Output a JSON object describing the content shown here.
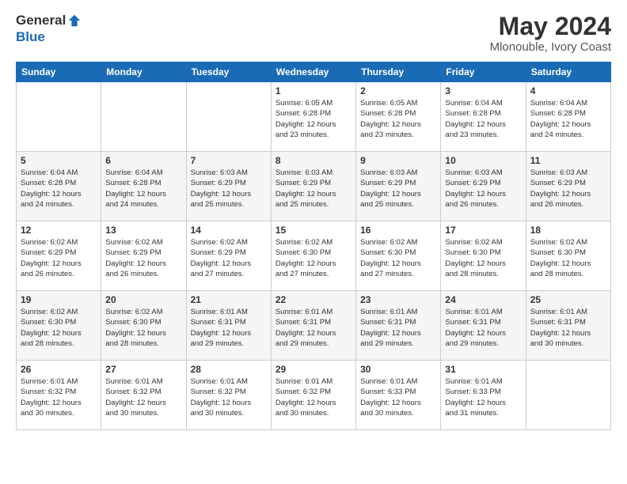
{
  "header": {
    "logo_general": "General",
    "logo_blue": "Blue",
    "month_title": "May 2024",
    "location": "Mlonouble, Ivory Coast"
  },
  "calendar": {
    "days_of_week": [
      "Sunday",
      "Monday",
      "Tuesday",
      "Wednesday",
      "Thursday",
      "Friday",
      "Saturday"
    ],
    "weeks": [
      [
        {
          "day": "",
          "info": ""
        },
        {
          "day": "",
          "info": ""
        },
        {
          "day": "",
          "info": ""
        },
        {
          "day": "1",
          "info": "Sunrise: 6:05 AM\nSunset: 6:28 PM\nDaylight: 12 hours\nand 23 minutes."
        },
        {
          "day": "2",
          "info": "Sunrise: 6:05 AM\nSunset: 6:28 PM\nDaylight: 12 hours\nand 23 minutes."
        },
        {
          "day": "3",
          "info": "Sunrise: 6:04 AM\nSunset: 6:28 PM\nDaylight: 12 hours\nand 23 minutes."
        },
        {
          "day": "4",
          "info": "Sunrise: 6:04 AM\nSunset: 6:28 PM\nDaylight: 12 hours\nand 24 minutes."
        }
      ],
      [
        {
          "day": "5",
          "info": "Sunrise: 6:04 AM\nSunset: 6:28 PM\nDaylight: 12 hours\nand 24 minutes."
        },
        {
          "day": "6",
          "info": "Sunrise: 6:04 AM\nSunset: 6:28 PM\nDaylight: 12 hours\nand 24 minutes."
        },
        {
          "day": "7",
          "info": "Sunrise: 6:03 AM\nSunset: 6:29 PM\nDaylight: 12 hours\nand 25 minutes."
        },
        {
          "day": "8",
          "info": "Sunrise: 6:03 AM\nSunset: 6:29 PM\nDaylight: 12 hours\nand 25 minutes."
        },
        {
          "day": "9",
          "info": "Sunrise: 6:03 AM\nSunset: 6:29 PM\nDaylight: 12 hours\nand 25 minutes."
        },
        {
          "day": "10",
          "info": "Sunrise: 6:03 AM\nSunset: 6:29 PM\nDaylight: 12 hours\nand 26 minutes."
        },
        {
          "day": "11",
          "info": "Sunrise: 6:03 AM\nSunset: 6:29 PM\nDaylight: 12 hours\nand 26 minutes."
        }
      ],
      [
        {
          "day": "12",
          "info": "Sunrise: 6:02 AM\nSunset: 6:29 PM\nDaylight: 12 hours\nand 26 minutes."
        },
        {
          "day": "13",
          "info": "Sunrise: 6:02 AM\nSunset: 6:29 PM\nDaylight: 12 hours\nand 26 minutes."
        },
        {
          "day": "14",
          "info": "Sunrise: 6:02 AM\nSunset: 6:29 PM\nDaylight: 12 hours\nand 27 minutes."
        },
        {
          "day": "15",
          "info": "Sunrise: 6:02 AM\nSunset: 6:30 PM\nDaylight: 12 hours\nand 27 minutes."
        },
        {
          "day": "16",
          "info": "Sunrise: 6:02 AM\nSunset: 6:30 PM\nDaylight: 12 hours\nand 27 minutes."
        },
        {
          "day": "17",
          "info": "Sunrise: 6:02 AM\nSunset: 6:30 PM\nDaylight: 12 hours\nand 28 minutes."
        },
        {
          "day": "18",
          "info": "Sunrise: 6:02 AM\nSunset: 6:30 PM\nDaylight: 12 hours\nand 28 minutes."
        }
      ],
      [
        {
          "day": "19",
          "info": "Sunrise: 6:02 AM\nSunset: 6:30 PM\nDaylight: 12 hours\nand 28 minutes."
        },
        {
          "day": "20",
          "info": "Sunrise: 6:02 AM\nSunset: 6:30 PM\nDaylight: 12 hours\nand 28 minutes."
        },
        {
          "day": "21",
          "info": "Sunrise: 6:01 AM\nSunset: 6:31 PM\nDaylight: 12 hours\nand 29 minutes."
        },
        {
          "day": "22",
          "info": "Sunrise: 6:01 AM\nSunset: 6:31 PM\nDaylight: 12 hours\nand 29 minutes."
        },
        {
          "day": "23",
          "info": "Sunrise: 6:01 AM\nSunset: 6:31 PM\nDaylight: 12 hours\nand 29 minutes."
        },
        {
          "day": "24",
          "info": "Sunrise: 6:01 AM\nSunset: 6:31 PM\nDaylight: 12 hours\nand 29 minutes."
        },
        {
          "day": "25",
          "info": "Sunrise: 6:01 AM\nSunset: 6:31 PM\nDaylight: 12 hours\nand 30 minutes."
        }
      ],
      [
        {
          "day": "26",
          "info": "Sunrise: 6:01 AM\nSunset: 6:32 PM\nDaylight: 12 hours\nand 30 minutes."
        },
        {
          "day": "27",
          "info": "Sunrise: 6:01 AM\nSunset: 6:32 PM\nDaylight: 12 hours\nand 30 minutes."
        },
        {
          "day": "28",
          "info": "Sunrise: 6:01 AM\nSunset: 6:32 PM\nDaylight: 12 hours\nand 30 minutes."
        },
        {
          "day": "29",
          "info": "Sunrise: 6:01 AM\nSunset: 6:32 PM\nDaylight: 12 hours\nand 30 minutes."
        },
        {
          "day": "30",
          "info": "Sunrise: 6:01 AM\nSunset: 6:33 PM\nDaylight: 12 hours\nand 30 minutes."
        },
        {
          "day": "31",
          "info": "Sunrise: 6:01 AM\nSunset: 6:33 PM\nDaylight: 12 hours\nand 31 minutes."
        },
        {
          "day": "",
          "info": ""
        }
      ]
    ]
  }
}
